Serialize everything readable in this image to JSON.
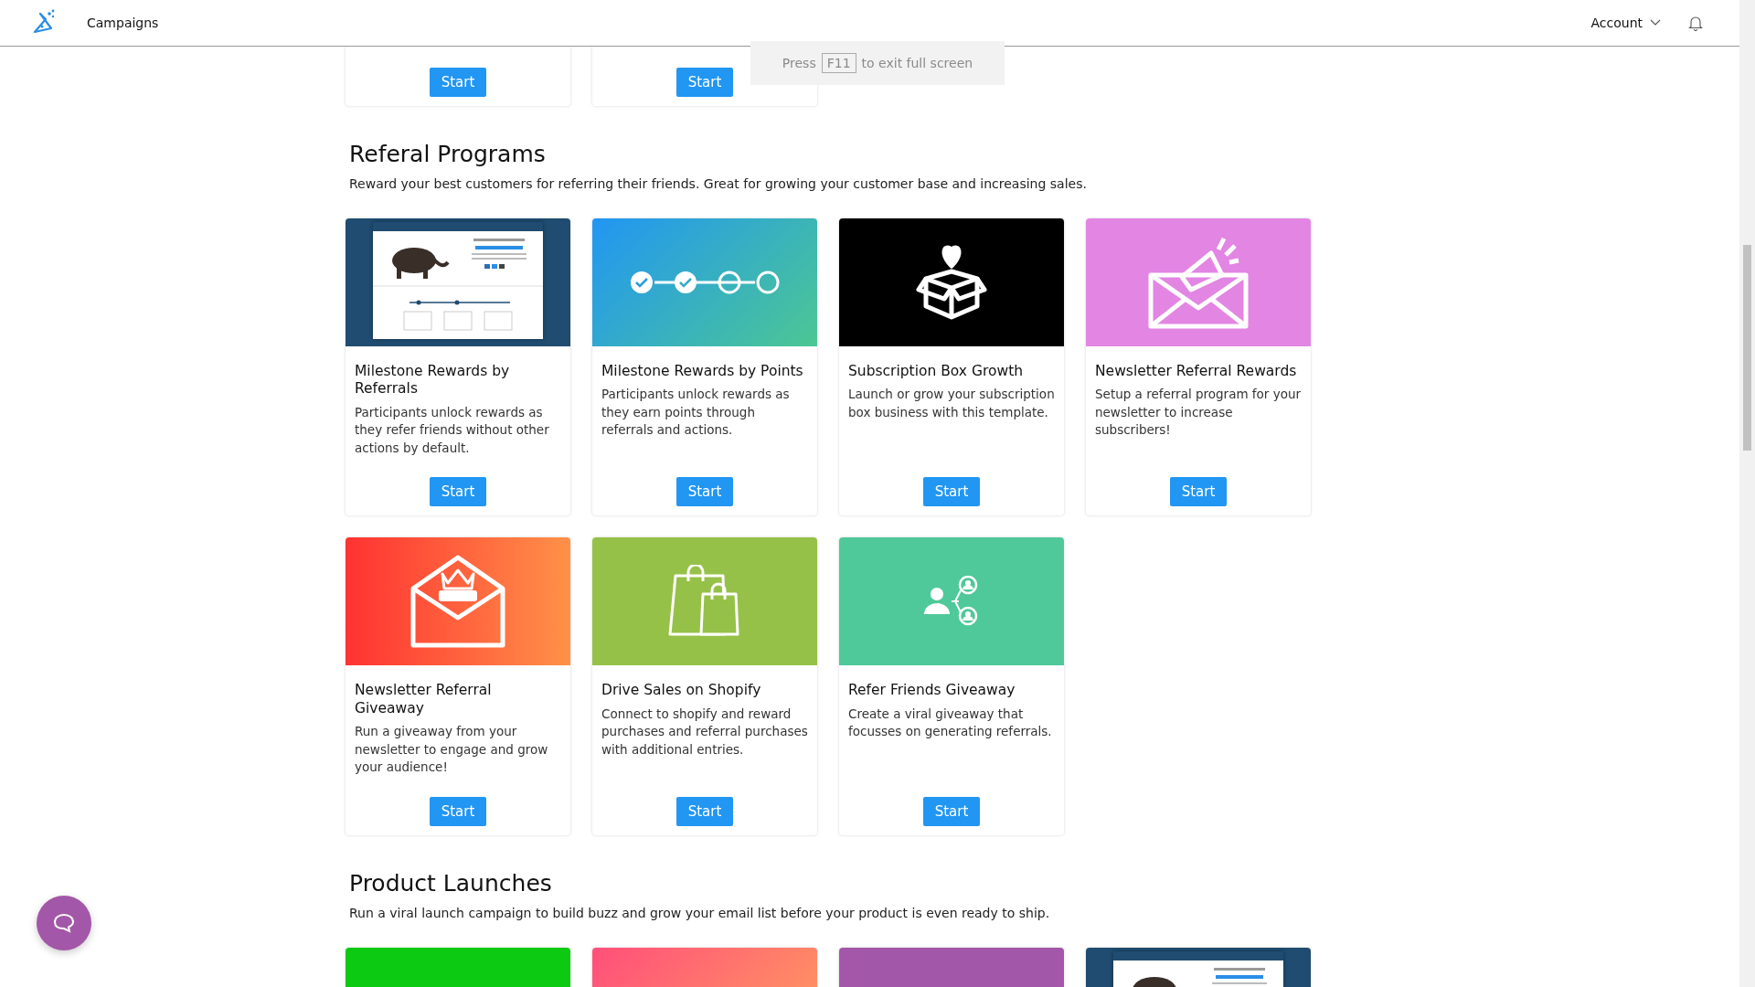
{
  "header": {
    "nav_title": "Campaigns",
    "account": "Account"
  },
  "fullscreen_notice": {
    "before": "Press",
    "key": "F11",
    "after": "to exit full screen"
  },
  "top_cards": [
    {
      "button": "Start"
    },
    {
      "button": "Start"
    }
  ],
  "sections": [
    {
      "title": "Referal Programs",
      "description": "Reward your best customers for referring their friends. Great for growing your customer base and increasing sales.",
      "cards": [
        {
          "kind": "mammoth-preview",
          "title": "Milestone Rewards by Referrals",
          "description": "Participants unlock rewards as they refer friends without other actions by default.",
          "button": "Start"
        },
        {
          "kind": "steps",
          "title": "Milestone Rewards by Points",
          "description": "Participants unlock rewards as they earn points through referrals and actions.",
          "button": "Start"
        },
        {
          "kind": "gift-box",
          "title": "Subscription Box Growth",
          "description": "Launch or grow your subscription box business with this template.",
          "button": "Start"
        },
        {
          "kind": "megaphone-envelope",
          "title": "Newsletter Referral Rewards",
          "description": "Setup a referral program for your newsletter to increase subscribers!",
          "button": "Start"
        },
        {
          "kind": "winner-envelope",
          "title": "Newsletter Referral Giveaway",
          "description": "Run a giveaway from your newsletter to engage and grow your audience!",
          "button": "Start"
        },
        {
          "kind": "shopping-bags",
          "title": "Drive Sales on Shopify",
          "description": "Connect to shopify and reward purchases and referral purchases with additional entries.",
          "button": "Start"
        },
        {
          "kind": "referral-people",
          "title": "Refer Friends Giveaway",
          "description": "Create a viral giveaway that focusses on generating referrals.",
          "button": "Start"
        }
      ]
    },
    {
      "title": "Product Launches",
      "description": "Run a viral launch campaign to build buzz and grow your email list before your product is even ready to ship.",
      "cards": [
        {
          "kind": "green-preview"
        },
        {
          "kind": "gradient-preview"
        },
        {
          "kind": "purple-preview"
        },
        {
          "kind": "mammoth-preview"
        }
      ]
    }
  ]
}
